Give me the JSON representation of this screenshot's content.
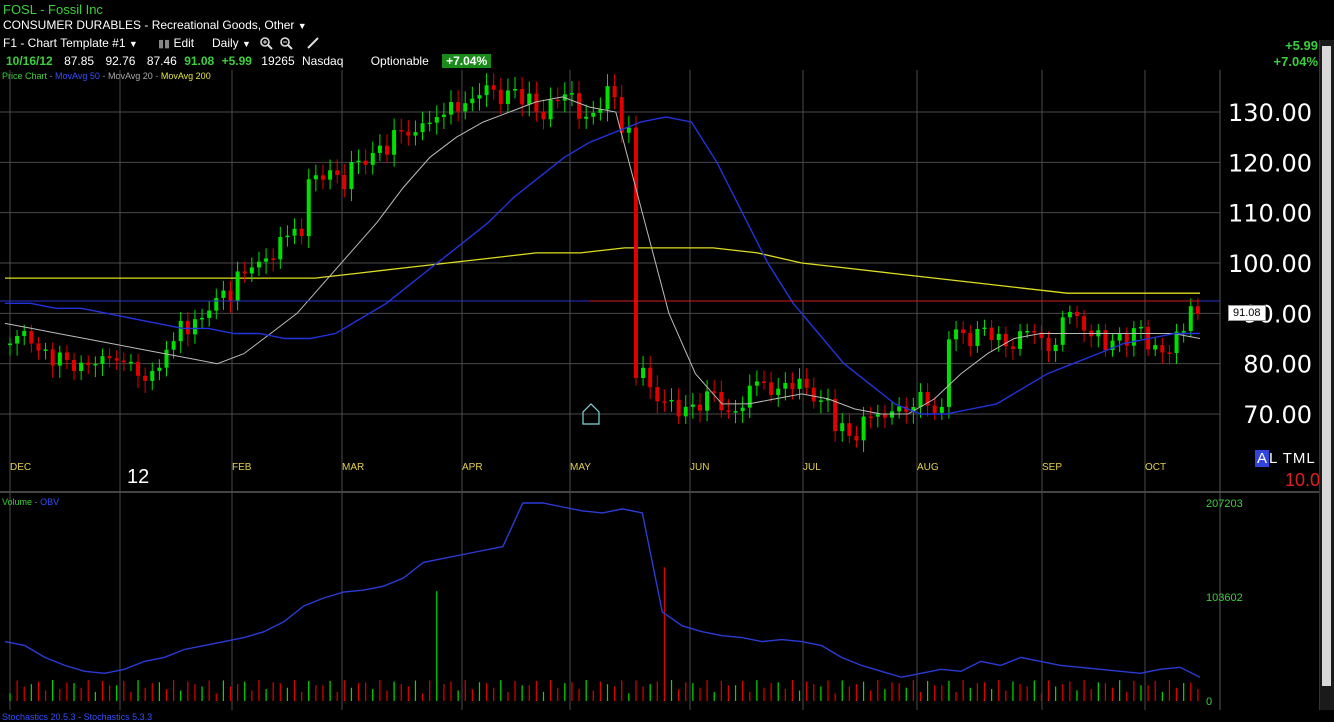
{
  "header": {
    "symbol_line": "FOSL - Fossil Inc",
    "sector": "CONSUMER DURABLES - Recreational Goods, Other",
    "template": "F1 - Chart Template #1",
    "edit_label": "Edit",
    "period_label": "Daily",
    "quote": {
      "date": "10/16/12",
      "open": "87.85",
      "high": "92.76",
      "low": "87.46",
      "close": "91.08",
      "change": "+5.99",
      "volume": "19265",
      "exchange": "Nasdaq",
      "optionable": "Optionable",
      "pct_badge": "+7.04%"
    },
    "right_change": "+5.99",
    "right_pct": "+7.04%"
  },
  "legend": {
    "price": "Price Chart",
    "ma50": "MovAvg 50",
    "ma20": "MovAvg 20",
    "ma200": "MovAvg 200",
    "volume": "Volume",
    "obv": "OBV",
    "stoch1": "Stochastics 20.5.3",
    "stoch2": "Stochastics 5.3.3"
  },
  "price_panel": {
    "y_ticks": [
      "130.00",
      "120.00",
      "110.00",
      "100.00",
      "90.00",
      "80.00",
      "70.00"
    ],
    "last_price_tag": "91.08",
    "year_label": "12",
    "atml_a": "A",
    "atml_rest": "L TML",
    "atml_value": "10.0"
  },
  "volume_panel": {
    "y_ticks": [
      "207203",
      "103602",
      "0"
    ]
  },
  "colors": {
    "up": "#00e000",
    "down": "#e00000",
    "ma50": "#2233dd",
    "ma20": "#bbbbbb",
    "ma200": "#dddd22",
    "obv": "#2a3bd6",
    "grid": "#4a4a4a",
    "month_label": "#e5d04a",
    "axis_text": "#ffffff",
    "vol_axis": "#3ccf3c"
  },
  "chart_data": {
    "type": "candlestick",
    "title": "FOSL - Fossil Inc",
    "x_months": [
      "DEC",
      "FEB",
      "MAR",
      "APR",
      "MAY",
      "JUN",
      "JUL",
      "AUG",
      "SEP",
      "OCT"
    ],
    "y_range": [
      63,
      138
    ],
    "close_path": [
      84,
      85,
      83,
      81,
      80,
      79,
      81,
      82,
      79,
      77,
      80,
      83,
      87,
      89,
      92,
      94,
      97,
      100,
      102,
      104,
      106,
      118,
      117,
      116,
      120,
      121,
      123,
      125,
      126,
      129,
      128,
      131,
      133,
      134,
      133,
      134,
      133,
      130,
      131,
      134,
      130,
      129,
      134,
      127,
      78,
      74,
      72,
      71,
      72,
      73,
      71,
      72,
      75,
      75,
      76,
      76,
      74,
      72,
      68,
      66,
      68,
      70,
      72,
      70,
      73,
      71,
      86,
      85,
      86,
      86,
      84,
      85,
      86,
      84,
      89,
      88,
      86,
      84,
      85,
      86,
      84,
      83,
      85,
      91
    ],
    "ma50": [
      92,
      92,
      91,
      91,
      90,
      89,
      88,
      87,
      87,
      86,
      86,
      85,
      85,
      86,
      89,
      92,
      96,
      100,
      104,
      108,
      113,
      117,
      121,
      124,
      126,
      128,
      129,
      128,
      120,
      110,
      100,
      92,
      86,
      80,
      76,
      72,
      70,
      70,
      71,
      72,
      75,
      78,
      80,
      82,
      84,
      85,
      86,
      86
    ],
    "ma20": [
      88,
      87,
      86,
      85,
      84,
      83,
      82,
      81,
      80,
      82,
      86,
      90,
      96,
      102,
      108,
      115,
      121,
      125,
      128,
      130,
      132,
      133,
      131,
      130,
      110,
      90,
      78,
      72,
      72,
      73,
      74,
      73,
      71,
      70,
      70,
      73,
      78,
      82,
      85,
      86,
      86,
      86,
      86,
      86,
      86,
      85
    ],
    "ma200": [
      97,
      97,
      97,
      97,
      97,
      97,
      97,
      97,
      98,
      99,
      100,
      101,
      102,
      102,
      103,
      103,
      103,
      102,
      100,
      99,
      98,
      97,
      96,
      95,
      94,
      94,
      94,
      94
    ],
    "last_close": 91.08,
    "volume_max": 207203,
    "volume_mid": 103602
  }
}
